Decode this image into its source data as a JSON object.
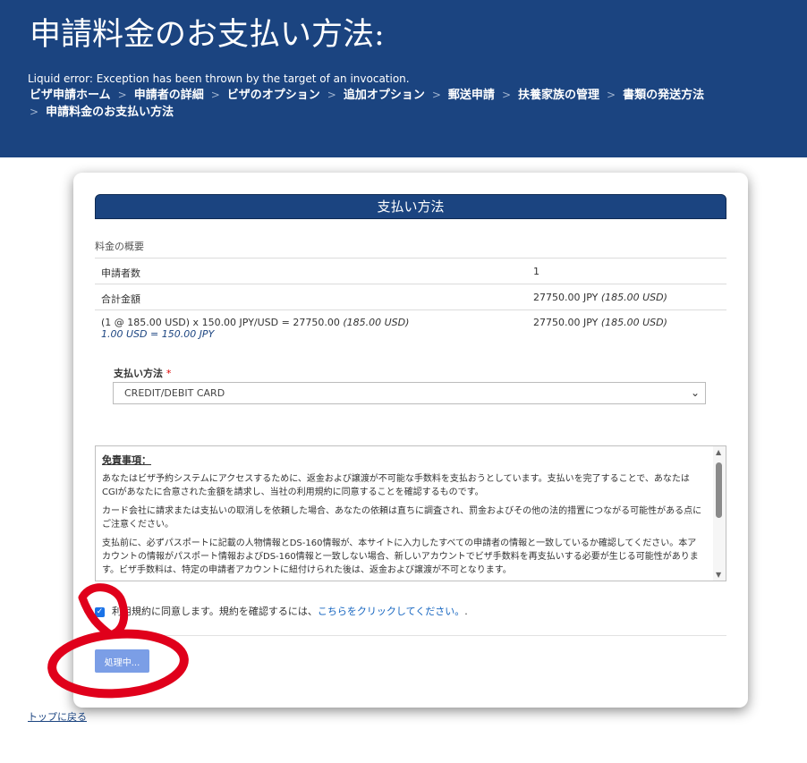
{
  "header": {
    "title": "申請料金のお支払い方法:",
    "error": "Liquid error: Exception has been thrown by the target of an invocation.",
    "breadcrumb": [
      "ビザ申請ホーム",
      "申請者の詳細",
      "ビザのオプション",
      "追加オプション",
      "郵送申請",
      "扶養家族の管理",
      "書類の発送方法",
      "申請料金のお支払い方法"
    ]
  },
  "payment": {
    "section_title": "支払い方法",
    "summary_caption": "料金の概要",
    "rows": {
      "applicants_label": "申請者数",
      "applicants_value": "1",
      "total_label": "合計金額",
      "total_jpy": "27750.00 JPY",
      "total_usd": "(185.00 USD)",
      "calc_label": "(1 @ 185.00 USD) x 150.00 JPY/USD = 27750.00",
      "calc_usd": "(185.00 USD)",
      "rate_note": "1.00 USD = 150.00 JPY",
      "calc_jpy": "27750.00 JPY",
      "calc_value_usd": "(185.00 USD)"
    },
    "method_label": "支払い方法",
    "required_mark": "*",
    "method_value": "CREDIT/DEBIT CARD"
  },
  "disclaimer": {
    "title": "免責事項：",
    "paragraphs": [
      "あなたはビザ予約システムにアクセスするために、返金および譲渡が不可能な手数料を支払おうとしています。支払いを完了することで、あなたはCGIがあなたに合意された金額を請求し、当社の利用規約に同意することを確認するものです。",
      "カード会社に請求または支払いの取消しを依頼した場合、あなたの依頼は直ちに調査され、罰金およびその他の法的措置につながる可能性がある点にご注意ください。",
      "支払前に、必ずパスポートに記載の人物情報とDS-160情報が、本サイトに入力したすべての申請者の情報と一致しているか確認してください。本アカウントの情報がパスポート情報およびDS-160情報と一致しない場合、新しいアカウントでビザ手数料を再支払いする必要が生じる可能性があります。ビザ手数料は、特定の申請者アカウントに紐付けられた後は、返金および譲渡が不可となります。"
    ]
  },
  "agreement": {
    "text": "利用規約に同意します。規約を確認するには、",
    "link": "こちらをクリックしてください。",
    "suffix": "."
  },
  "process_button": "処理中...",
  "back_to_top": "トップに戻る",
  "colors": {
    "header_bg": "#1b4480",
    "button": "#7b9ee6",
    "link": "#1565c0",
    "annotation": "#e0001b"
  },
  "icons": [
    "chevron-down-icon",
    "checkbox-checked-icon",
    "scroll-up-icon",
    "scroll-down-icon"
  ]
}
